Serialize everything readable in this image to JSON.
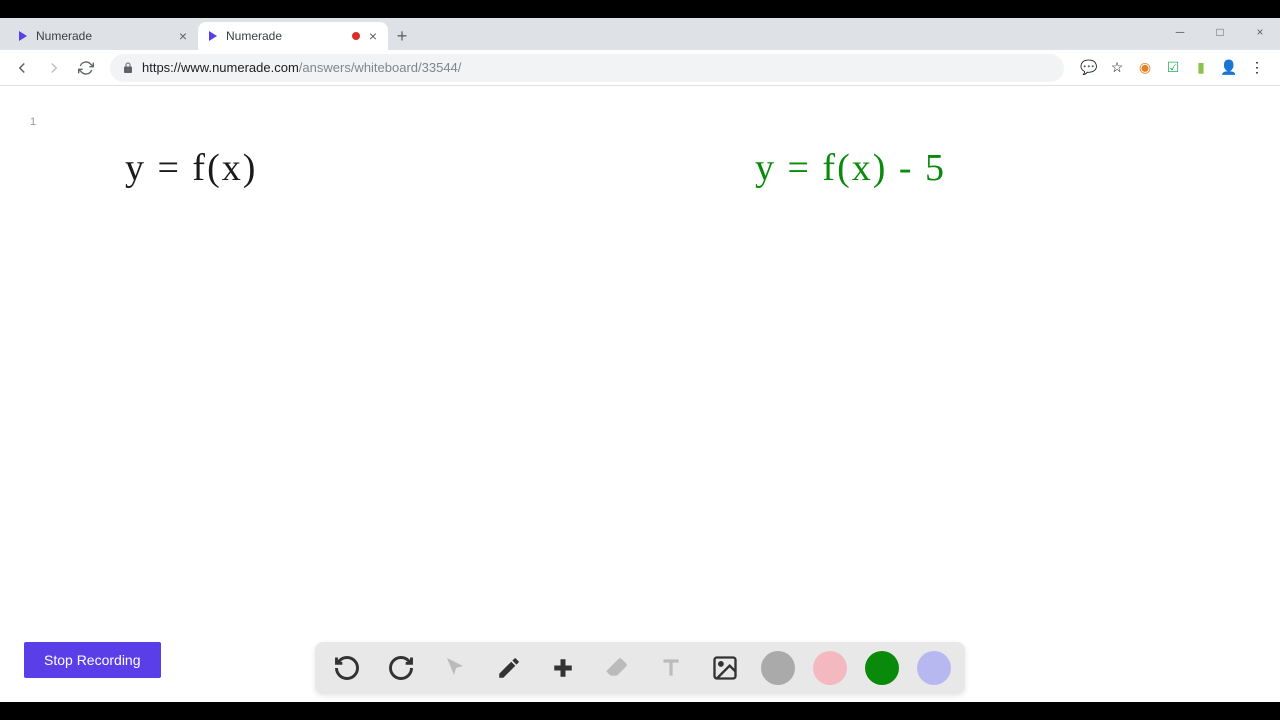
{
  "tabs": [
    {
      "title": "Numerade",
      "active": false
    },
    {
      "title": "Numerade",
      "active": true,
      "recording": true
    }
  ],
  "url": {
    "domain": "https://www.numerade.com",
    "path": "/answers/whiteboard/33544/"
  },
  "whiteboard": {
    "left_equation": "y = f(x)",
    "right_equation": "y = f(x) - 5"
  },
  "buttons": {
    "stop_recording": "Stop Recording"
  },
  "colors": {
    "accent": "#5a3ee8",
    "green": "#0a8a0a",
    "black": "#1a1a1a"
  },
  "page_num": "1"
}
